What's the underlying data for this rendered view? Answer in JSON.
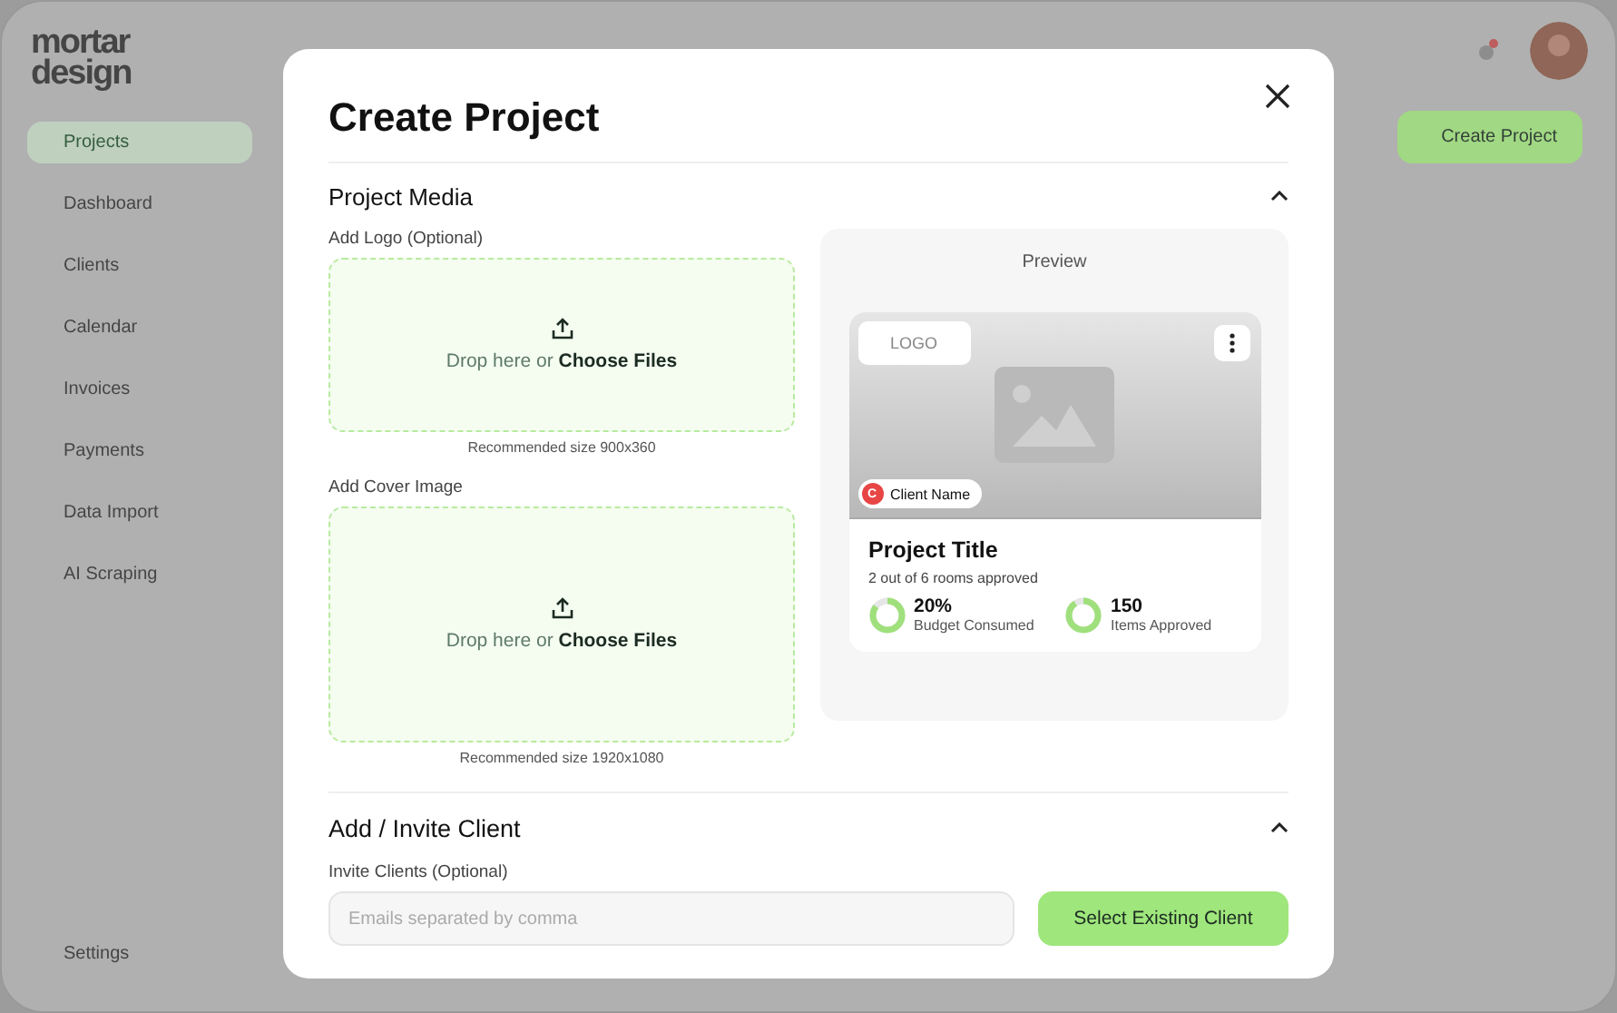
{
  "app": {
    "logo": "mortar design",
    "nav": [
      {
        "label": "Projects",
        "selected": true
      },
      {
        "label": "Dashboard",
        "selected": false
      },
      {
        "label": "Clients",
        "selected": false
      },
      {
        "label": "Calendar",
        "selected": false
      },
      {
        "label": "Invoices",
        "selected": false
      },
      {
        "label": "Payments",
        "selected": false
      },
      {
        "label": "Data Import",
        "selected": false
      },
      {
        "label": "AI Scraping",
        "selected": false
      }
    ],
    "settings": "Settings",
    "create_button": "Create Project"
  },
  "modal": {
    "title": "Create Project",
    "media": {
      "title": "Project Media",
      "expanded": true,
      "uploads": [
        {
          "label": "Add Logo (Optional)",
          "hint": "Drop here or ",
          "link": "Choose Files",
          "caption": "Recommended size 900x360",
          "kind": "small"
        },
        {
          "label": "Add Cover Image",
          "hint": "Drop here or ",
          "link": "Choose Files",
          "caption": "Recommended size 1920x1080",
          "kind": "large"
        }
      ],
      "preview": {
        "title": "Preview",
        "logo": "LOGO",
        "client_initial": "C",
        "client": "Client Name",
        "project_title": "Project Title",
        "subtitle": "2 out of 6 rooms approved",
        "stats": [
          {
            "value": "20%",
            "label": "Budget Consumed",
            "level": 0.85
          },
          {
            "value": "150",
            "label": "Items Approved",
            "level": 0.9
          }
        ]
      }
    },
    "client": {
      "title": "Add / Invite Client",
      "expanded": true,
      "label": "Invite Clients (Optional)",
      "placeholder": "Emails separated by comma",
      "button": "Select Existing Client"
    }
  }
}
